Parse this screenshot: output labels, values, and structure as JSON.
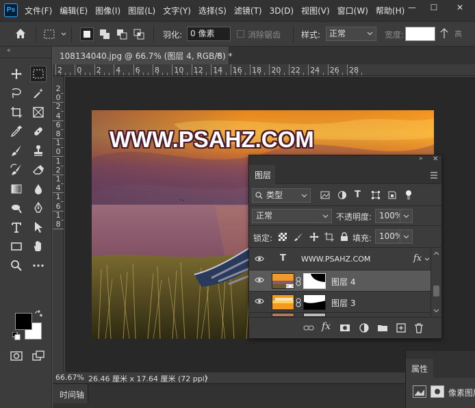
{
  "app": {
    "logo": "Ps"
  },
  "menu": [
    "文件(F)",
    "编辑(E)",
    "图像(I)",
    "图层(L)",
    "文字(Y)",
    "选择(S)",
    "滤镜(T)",
    "3D(D)",
    "视图(V)",
    "窗口(W)",
    "帮助(H)"
  ],
  "window_controls": {
    "minimize": "—",
    "maximize": "☐",
    "close": "✕"
  },
  "options": {
    "feather_label": "羽化:",
    "feather_value": "0 像素",
    "antialias_label": "消除锯齿",
    "style_label": "样式:",
    "style_value": "正常",
    "width_label": "宽度:"
  },
  "document": {
    "tab_title": "108134040.jpg @ 66.7% (图层 4, RGB/8) *",
    "close": "×",
    "watermark_text": "WWW.PSAHZ.COM"
  },
  "ruler_h": [
    "2",
    "0",
    "2",
    "4",
    "6",
    "8",
    "10",
    "12",
    "14",
    "16",
    "18",
    "20",
    "22",
    "24",
    "26",
    "28"
  ],
  "ruler_v": [
    "2",
    "0",
    "2",
    "4",
    "6",
    "8",
    "1",
    "0",
    "1",
    "2",
    "1",
    "4",
    "1",
    "6",
    "1",
    "8"
  ],
  "status": {
    "zoom": "66.67%",
    "doc_size": "26.46 厘米 x 17.64 厘米 (72 ppi)",
    "arrow": "〉"
  },
  "timeline": {
    "label": "时间轴"
  },
  "properties": {
    "title": "属性",
    "text": "像素图层"
  },
  "layers_panel": {
    "title": "图层",
    "filter_value": "类型",
    "blend_mode": "正常",
    "opacity_label": "不透明度:",
    "opacity_value": "100%",
    "lock_label": "锁定:",
    "fill_label": "填充:",
    "fill_value": "100%",
    "layers": [
      {
        "name": "WWW.PSAHZ.COM",
        "type": "text",
        "visible": true,
        "selected": false,
        "fx": "fx"
      },
      {
        "name": "图层 4",
        "type": "pixel-with-mask",
        "visible": true,
        "selected": true
      },
      {
        "name": "图层 3",
        "type": "pixel-with-mask",
        "visible": true,
        "selected": false
      }
    ],
    "type_glyph": "T"
  },
  "colors": {
    "accent": "#31a8ff",
    "foreground": "#000000",
    "background": "#ffffff",
    "sky_orange": "#f39a1c",
    "water": "#8c5a6a"
  }
}
